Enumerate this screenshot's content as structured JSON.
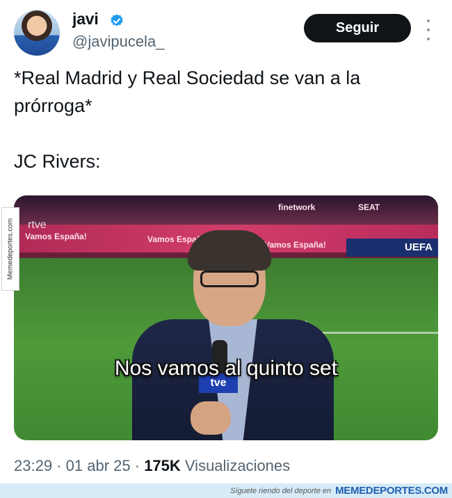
{
  "tweet": {
    "author_name": "javi",
    "author_handle": "@javipucela_",
    "follow_label": "Seguir",
    "text": "*Real Madrid y Real Sociedad se van a la\nprórroga*\n\nJC Rivers:",
    "media_caption": "Nos vamos al quinto set",
    "time": "23:29",
    "date": "01 abr 25",
    "views_count": "175K",
    "views_label": "Visualizaciones",
    "separator": "·"
  },
  "media_scene": {
    "broadcaster_logo": "rtve",
    "mic_logo": "tve",
    "ad_texts": [
      "Vamos España!",
      "Vamos España!",
      "Vamos España!",
      "UEFA",
      "finetwork",
      "SEAT"
    ]
  },
  "watermark": {
    "side_text": "Memedeportes.com",
    "footer_text": "Síguete riendo del deporte en",
    "footer_brand": "MEMEDEPORTES.COM"
  },
  "colors": {
    "verified": "#1d9bf0",
    "follow_button_bg": "#0f1419",
    "secondary_text": "#536471"
  },
  "icons": [
    "verified-badge-icon",
    "more-options-icon"
  ]
}
